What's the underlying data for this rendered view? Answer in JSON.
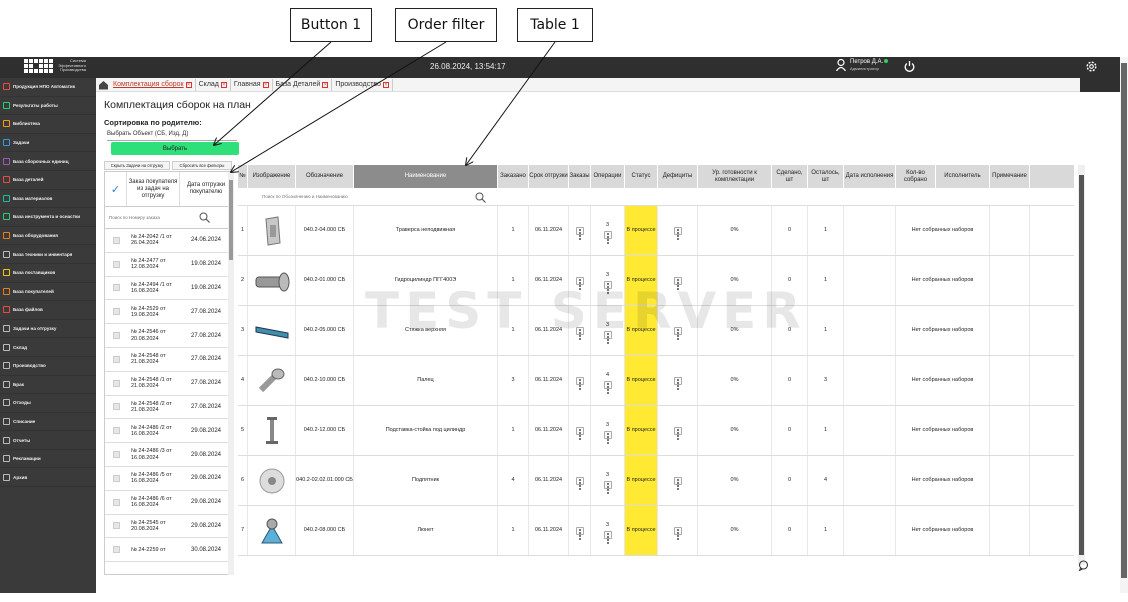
{
  "annotations": {
    "button1": "Button 1",
    "order_filter": "Order filter",
    "table1": "Table 1"
  },
  "header": {
    "logo_text": [
      "Система",
      "Эффективного",
      "Производства"
    ],
    "datetime": "26.08.2024, 13:54:17",
    "user_name": "Петров Д.А.",
    "user_role": "Администратор"
  },
  "sidebar": {
    "items": [
      {
        "label": "Продукция НПО Автоматик",
        "icon": "product-icon"
      },
      {
        "label": "Результаты работы",
        "icon": "results-icon"
      },
      {
        "label": "Библиотека",
        "icon": "library-icon"
      },
      {
        "label": "Задачи",
        "icon": "tasks-icon"
      },
      {
        "label": "База сборочных единиц",
        "icon": "assembly-db-icon"
      },
      {
        "label": "База деталей",
        "icon": "parts-db-icon"
      },
      {
        "label": "База материалов",
        "icon": "materials-db-icon"
      },
      {
        "label": "База инструмента и оснастки",
        "icon": "tools-db-icon"
      },
      {
        "label": "База оборудования",
        "icon": "equipment-db-icon"
      },
      {
        "label": "База техники и инвентаря",
        "icon": "inventory-db-icon"
      },
      {
        "label": "База поставщиков",
        "icon": "suppliers-db-icon"
      },
      {
        "label": "База покупателей",
        "icon": "customers-db-icon"
      },
      {
        "label": "База файлов",
        "icon": "files-db-icon"
      },
      {
        "label": "Задачи на отгрузку",
        "icon": "shipping-tasks-icon"
      },
      {
        "label": "Склад",
        "icon": "warehouse-icon"
      },
      {
        "label": "Производство",
        "icon": "production-icon"
      },
      {
        "label": "Брак",
        "icon": "defect-icon"
      },
      {
        "label": "Отходы",
        "icon": "waste-icon"
      },
      {
        "label": "Списание",
        "icon": "writeoff-icon"
      },
      {
        "label": "Отчеты",
        "icon": "reports-icon"
      },
      {
        "label": "Рекламации",
        "icon": "claims-icon"
      },
      {
        "label": "Архив",
        "icon": "archive-icon"
      }
    ],
    "colors": {
      "bg": "#3a3a3a",
      "text": "#f0f0f0"
    }
  },
  "tabs": [
    {
      "label": "Комплектация сборок",
      "active": true
    },
    {
      "label": "Склад",
      "active": false
    },
    {
      "label": "Главная",
      "active": false
    },
    {
      "label": "База Деталей",
      "active": false
    },
    {
      "label": "Производство",
      "active": false
    }
  ],
  "content": {
    "title": "Комплектация сборок на план",
    "sort_label": "Сортировка по родителю:",
    "object_select": "Выбрать Объект (СБ, Изд, Д)",
    "choose_button": "Выбрать",
    "hide_shipping_tasks": "Скрыть Задачи на отгрузку",
    "reset_filters": "Сбросить все фильтры"
  },
  "orders_table": {
    "col_order": "Заказ покупателя из задач на отгрузку",
    "col_date": "Дата отгрузки покупателю",
    "search_placeholder": "Поиск по Номеру заказа",
    "rows": [
      {
        "num": "№ 24-2042 /1 от 26.04.2024",
        "date": "24.06.2024"
      },
      {
        "num": "№ 24-2477 от 12.08.2024",
        "date": "19.08.2024"
      },
      {
        "num": "№ 24-2494 /1 от 16.08.2024",
        "date": "19.08.2024"
      },
      {
        "num": "№ 24-2529 от 19.08.2024",
        "date": "27.08.2024"
      },
      {
        "num": "№ 24-2546 от 20.08.2024",
        "date": "27.08.2024"
      },
      {
        "num": "№ 24-2548 от 21.08.2024",
        "date": "27.08.2024"
      },
      {
        "num": "№ 24-2548 /1 от 21.08.2024",
        "date": "27.08.2024"
      },
      {
        "num": "№ 24-2548 /2 от 21.08.2024",
        "date": "27.08.2024"
      },
      {
        "num": "№ 24-2486 /2 от 16.08.2024",
        "date": "29.08.2024"
      },
      {
        "num": "№ 24-2486 /3 от 16.08.2024",
        "date": "29.08.2024"
      },
      {
        "num": "№ 24-2486 /5 от 16.08.2024",
        "date": "29.08.2024"
      },
      {
        "num": "№ 24-2486 /6 от 16.08.2024",
        "date": "29.08.2024"
      },
      {
        "num": "№ 24-2545 от 20.08.2024",
        "date": "29.08.2024"
      },
      {
        "num": "№ 24-2259 от",
        "date": "30.08.2024"
      }
    ]
  },
  "main_table": {
    "headers": [
      "№",
      "Изображение",
      "Обозначение",
      "Наименование",
      "Заказано",
      "Срок отгрузки",
      "Заказы",
      "Операции",
      "Статус",
      "Дефициты",
      "Ур. готовности к комплектации",
      "Сделано, шт",
      "Осталось, шт",
      "Дата исполнения",
      "Кол-во собрано",
      "Исполнитель",
      "Примечание"
    ],
    "search_placeholder": "Поиск по Обозначению и Наименованию",
    "rows": [
      {
        "n": "1",
        "icon": "traverse-part-icon",
        "designation": "040.2-04.000 СБ",
        "name": "Траверса неподвижная",
        "ordered": "1",
        "due": "06.11.2024",
        "ops": "3",
        "status": "В процессе",
        "ready": "0%",
        "done": "0",
        "left": "1",
        "assembled": "Нет собранных наборов"
      },
      {
        "n": "2",
        "icon": "hydraulic-cylinder-icon",
        "designation": "040.2-01.000 СБ",
        "name": "Гидроцилиндр ПГГ400Э",
        "ordered": "1",
        "due": "06.11.2024",
        "ops": "3",
        "status": "В процессе",
        "ready": "0%",
        "done": "0",
        "left": "1",
        "assembled": "Нет собранных наборов"
      },
      {
        "n": "3",
        "icon": "upper-tie-icon",
        "designation": "040.2-05.000 СБ",
        "name": "Стяжка верхняя",
        "ordered": "1",
        "due": "06.11.2024",
        "ops": "3",
        "status": "В процессе",
        "ready": "0%",
        "done": "0",
        "left": "1",
        "assembled": "Нет собранных наборов"
      },
      {
        "n": "4",
        "icon": "pin-part-icon",
        "designation": "040.2-10.000 СБ",
        "name": "Палец",
        "ordered": "3",
        "due": "06.11.2024",
        "ops": "4",
        "status": "В процессе",
        "ready": "0%",
        "done": "0",
        "left": "3",
        "assembled": "Нет собранных наборов"
      },
      {
        "n": "5",
        "icon": "stand-part-icon",
        "designation": "040.2-12.000 СБ",
        "name": "Подставка-стойка под цилиндр",
        "ordered": "1",
        "due": "06.11.2024",
        "ops": "3",
        "status": "В процессе",
        "ready": "0%",
        "done": "0",
        "left": "1",
        "assembled": "Нет собранных наборов"
      },
      {
        "n": "6",
        "icon": "bearing-part-icon",
        "designation": "040.2-02.02.01.000 СБ",
        "name": "Подпятник",
        "ordered": "4",
        "due": "06.11.2024",
        "ops": "3",
        "status": "В процессе",
        "ready": "0%",
        "done": "0",
        "left": "4",
        "assembled": "Нет собранных наборов"
      },
      {
        "n": "7",
        "icon": "cradle-part-icon",
        "designation": "040.2-08.000 СБ",
        "name": "Люнет",
        "ordered": "1",
        "due": "06.11.2024",
        "ops": "3",
        "status": "В процессе",
        "ready": "0%",
        "done": "0",
        "left": "1",
        "assembled": "Нет собранных наборов"
      }
    ],
    "colors": {
      "header_bg": "#d9d9d9",
      "header_dark": "#8c8c8c",
      "status_bg": "#ffe933"
    }
  },
  "watermark": "TEST SERVER",
  "colors": {
    "topbar": "#2f2f2f",
    "accent_green": "#2fe07a",
    "active_tab": "#c0392b"
  }
}
